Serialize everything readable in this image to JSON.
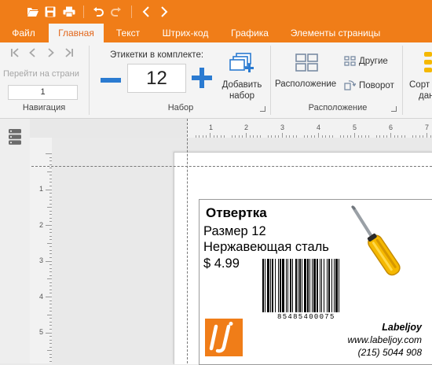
{
  "titlebar": {
    "icons": [
      "folder-open-icon",
      "save-icon",
      "print-icon",
      "undo-icon",
      "redo-icon",
      "back-icon",
      "forward-icon"
    ]
  },
  "menu": {
    "tabs": [
      "Файл",
      "Главная",
      "Текст",
      "Штрих-код",
      "Графика",
      "Элементы страницы"
    ],
    "active": "Главная"
  },
  "ribbon": {
    "navigation": {
      "goto_label": "Перейти на страни",
      "page_value": "1",
      "group_label": "Навигация"
    },
    "set": {
      "labels_in_set_label": "Этикетки в комплекте:",
      "count_value": "12",
      "add_set_label_line1": "Добавить",
      "add_set_label_line2": "набор",
      "group_label": "Набор"
    },
    "layout": {
      "layout_label": "Расположение",
      "other_label": "Другие",
      "rotate_label": "Поворот",
      "group_label": "Расположение"
    },
    "sort": {
      "label_line1": "Сорт",
      "label_line2": "дан"
    }
  },
  "ruler": {
    "h_numbers": [
      "1",
      "2",
      "3",
      "4",
      "5",
      "6",
      "7"
    ],
    "v_numbers": [
      "1",
      "2",
      "3",
      "4",
      "5"
    ]
  },
  "label": {
    "title": "Отвертка",
    "size": "Размер 12",
    "material": "Нержавеющая сталь",
    "price": "$ 4.99",
    "barcode_digits": "85485400075",
    "brand": "Labeljoy",
    "website": "www.labeljoy.com",
    "phone": "(215) 5044 908"
  },
  "colors": {
    "brand_orange": "#f07d18",
    "accent_blue": "#2b7bd1",
    "screwdriver_yellow": "#f5b800"
  }
}
